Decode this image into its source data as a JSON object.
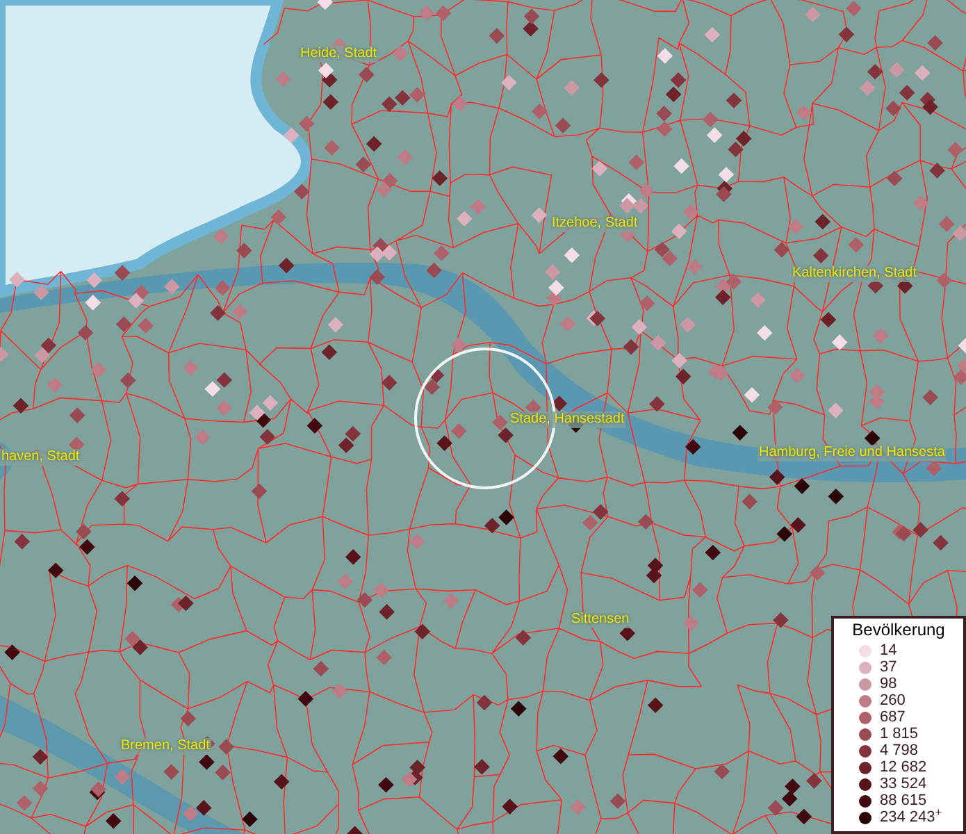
{
  "map": {
    "places": [
      {
        "label": "Heide, Stadt"
      },
      {
        "label": "Itzehoe, Stadt"
      },
      {
        "label": "Kaltenkirchen, Stadt"
      },
      {
        "label": "Stade, Hansestadt"
      },
      {
        "label": "haven, Stadt"
      },
      {
        "label": "Hamburg, Freie und Hansesta"
      },
      {
        "label": "Sittensen"
      },
      {
        "label": "Bremen, Stadt"
      }
    ]
  },
  "legend": {
    "title": "Bevölkerung",
    "classes": [
      {
        "value": "14",
        "color": "#f3dde6"
      },
      {
        "value": "37",
        "color": "#dcb0bc"
      },
      {
        "value": "98",
        "color": "#cc98a3"
      },
      {
        "value": "260",
        "color": "#bf7b86"
      },
      {
        "value": "687",
        "color": "#b06069"
      },
      {
        "value": "1 815",
        "color": "#9a4a52"
      },
      {
        "value": "4 798",
        "color": "#85343d"
      },
      {
        "value": "12 682",
        "color": "#6e2229"
      },
      {
        "value": "33 524",
        "color": "#58141a"
      },
      {
        "value": "88 615",
        "color": "#420a10"
      },
      {
        "value": "234 243$^{+}$",
        "color": "#2c0508"
      }
    ]
  }
}
